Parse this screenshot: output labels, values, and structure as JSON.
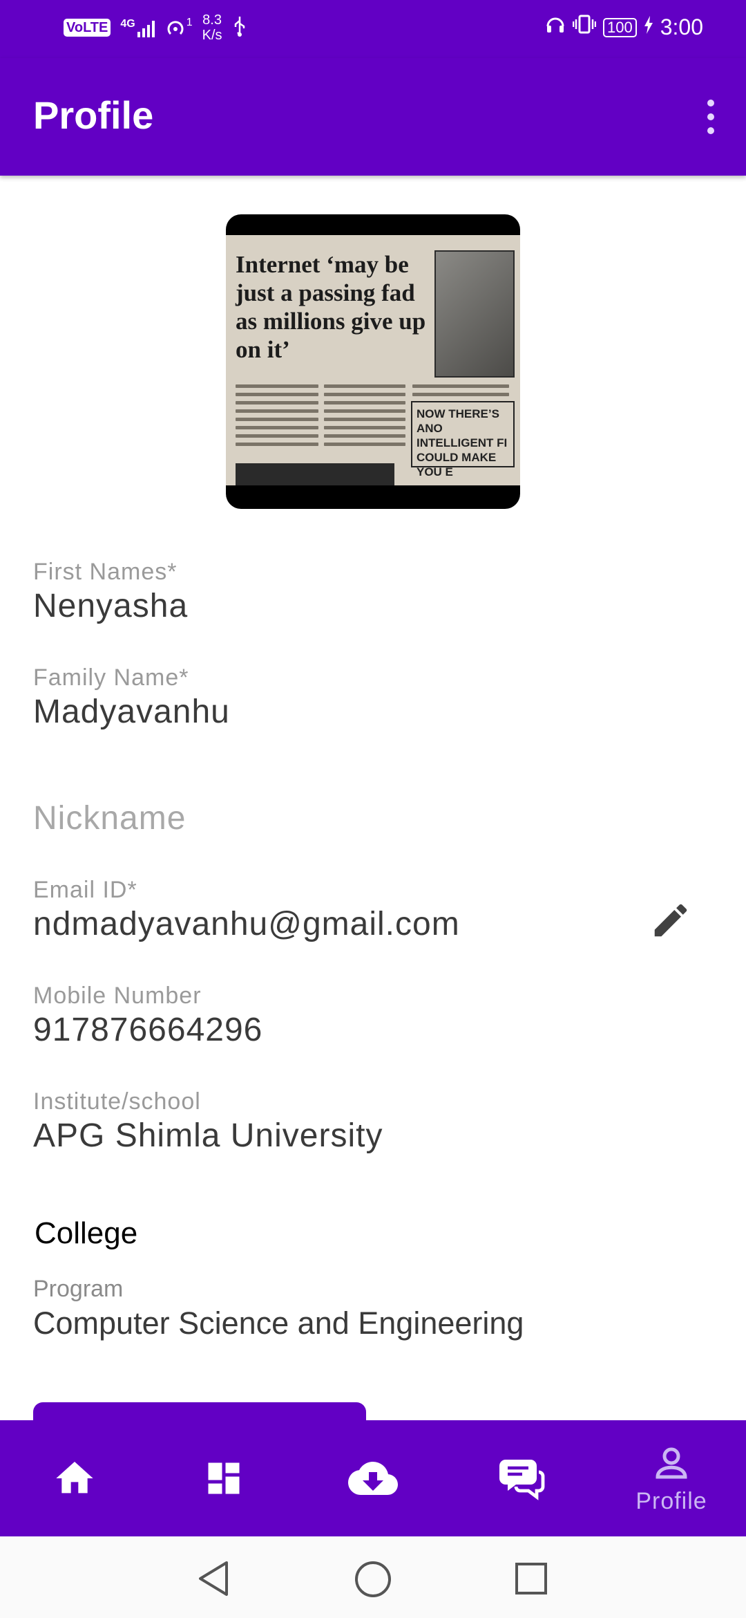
{
  "status_bar": {
    "volte": "VoLTE",
    "network": "4G",
    "hotspot_count": "1",
    "speed_value": "8.3",
    "speed_unit": "K/s",
    "battery": "100",
    "time": "3:00"
  },
  "app_bar": {
    "title": "Profile"
  },
  "profile": {
    "photo_text": {
      "headline": "Internet ‘may be just a passing fad as millions give up on it’",
      "box": "NOW THERE’S ANO INTELLIGENT FI COULD MAKE YOU E"
    },
    "first_names": {
      "label": "First Names*",
      "value": "Nenyasha"
    },
    "family_name": {
      "label": "Family Name*",
      "value": "Madyavanhu"
    },
    "nickname": {
      "placeholder": "Nickname"
    },
    "email": {
      "label": "Email ID*",
      "value": "ndmadyavanhu@gmail.com"
    },
    "mobile": {
      "label": "Mobile Number",
      "value": "917876664296"
    },
    "institute": {
      "label": "Institute/school",
      "value": "APG Shimla University"
    },
    "college_heading": "College",
    "program": {
      "label": "Program",
      "value": "Computer Science and Engineering"
    }
  },
  "bottom_nav": {
    "items": [
      {
        "icon": "home-icon"
      },
      {
        "icon": "dashboard-icon"
      },
      {
        "icon": "cloud-download-icon"
      },
      {
        "icon": "chat-icon"
      },
      {
        "icon": "person-icon",
        "label": "Profile",
        "active": true
      }
    ]
  },
  "colors": {
    "primary": "#6200c4",
    "nav_label": "#cbb7f3"
  }
}
